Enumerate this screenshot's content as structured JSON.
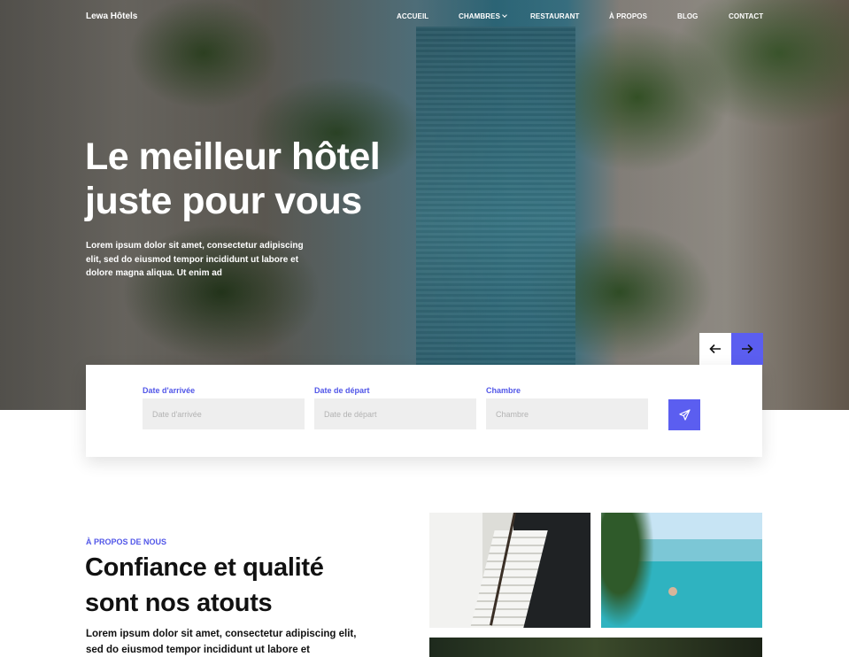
{
  "nav": {
    "brand": "Lewa Hôtels",
    "items": [
      {
        "label": "ACCUEIL"
      },
      {
        "label": "CHAMBRES",
        "has_dropdown": true
      },
      {
        "label": "RESTAURANT"
      },
      {
        "label": "À PROPOS"
      },
      {
        "label": "BLOG"
      },
      {
        "label": "CONTACT"
      }
    ]
  },
  "hero": {
    "title_line1": "Le meilleur hôtel",
    "title_line2": "juste pour vous",
    "text": "Lorem ipsum dolor sit amet, consectetur adipiscing elit, sed do eiusmod tempor incididunt ut labore et dolore magna aliqua. Ut enim ad"
  },
  "slider": {
    "prev_icon": "arrow-left-icon",
    "next_icon": "arrow-right-icon"
  },
  "booking": {
    "arrival": {
      "label": "Date d'arrivée",
      "placeholder": "Date d'arrivée",
      "value": ""
    },
    "departure": {
      "label": "Date de départ",
      "placeholder": "Date de départ",
      "value": ""
    },
    "room": {
      "label": "Chambre",
      "placeholder": "Chambre",
      "value": ""
    },
    "submit_icon": "send-icon"
  },
  "about": {
    "eyebrow": "À PROPOS DE NOUS",
    "title_line1": "Confiance et qualité",
    "title_line2": "sont nos atouts",
    "text": "Lorem ipsum dolor sit amet, consectetur adipiscing elit, sed do eiusmod tempor incididunt ut labore et"
  },
  "colors": {
    "accent": "#5b5ef0",
    "input_bg": "#eeeeee",
    "text": "#111111"
  }
}
